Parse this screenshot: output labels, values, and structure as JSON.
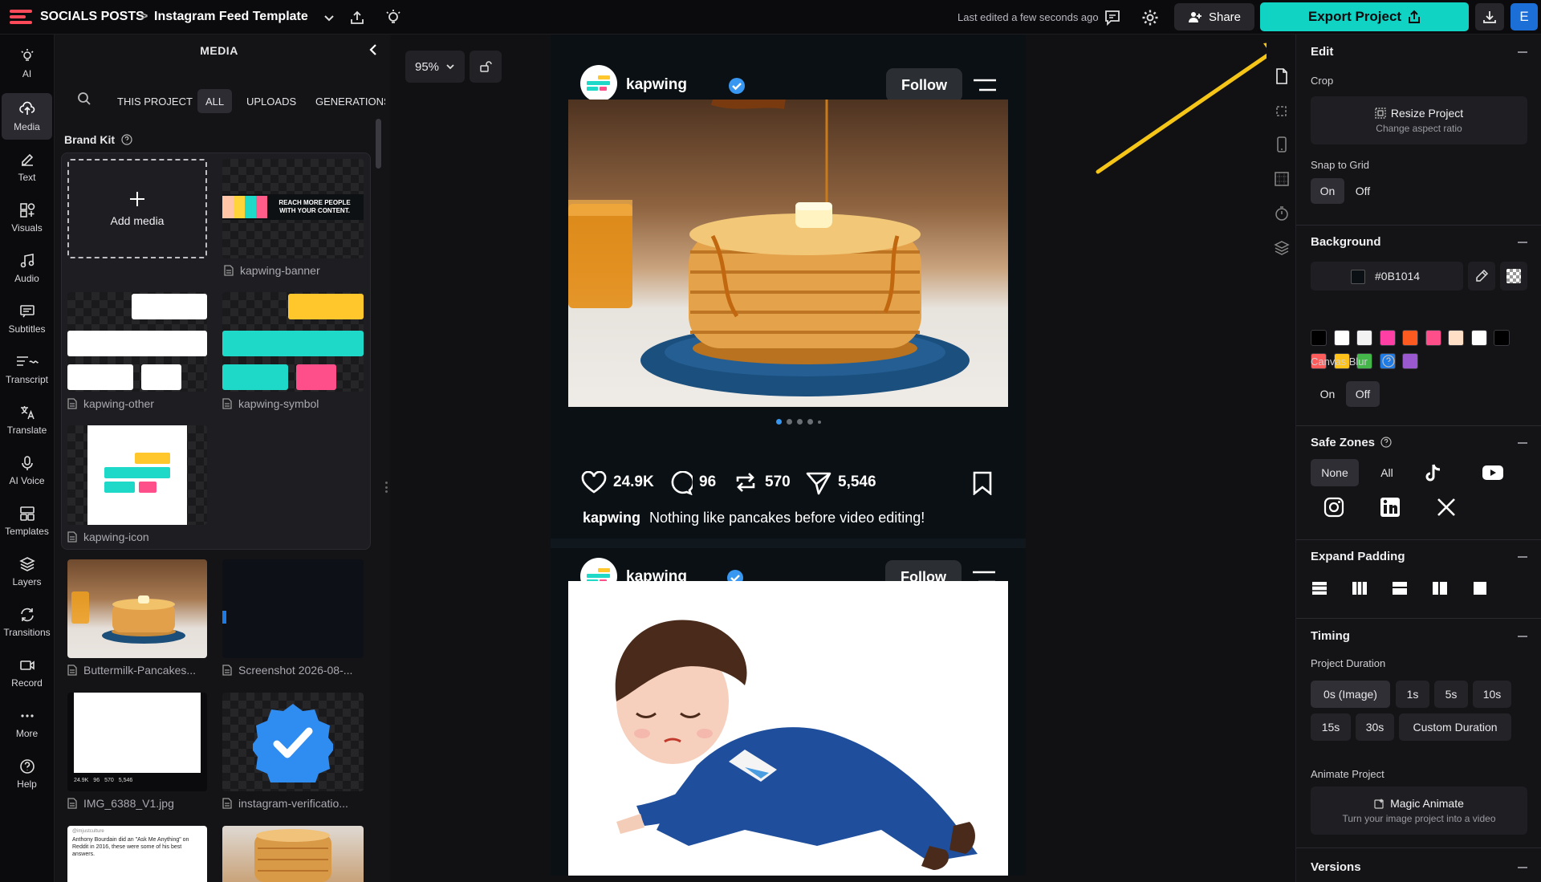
{
  "topbar": {
    "project_folder": "SOCIALS POSTS",
    "separator": ">",
    "project_name": "Instagram Feed Template",
    "last_edited": "Last edited a few seconds ago",
    "share_label": "Share",
    "export_label": "Export Project",
    "avatar_letter": "E"
  },
  "leftnav": {
    "items": [
      {
        "label": "AI",
        "icon": "ai-icon"
      },
      {
        "label": "Media",
        "icon": "upload-icon"
      },
      {
        "label": "Text",
        "icon": "text-icon"
      },
      {
        "label": "Visuals",
        "icon": "shapes-icon"
      },
      {
        "label": "Audio",
        "icon": "music-icon"
      },
      {
        "label": "Subtitles",
        "icon": "subtitles-icon"
      },
      {
        "label": "Transcript",
        "icon": "transcript-icon"
      },
      {
        "label": "Translate",
        "icon": "translate-icon"
      },
      {
        "label": "AI Voice",
        "icon": "microphone-icon"
      },
      {
        "label": "Templates",
        "icon": "templates-icon"
      },
      {
        "label": "Layers",
        "icon": "layers-icon"
      },
      {
        "label": "Transitions",
        "icon": "transitions-icon"
      },
      {
        "label": "Record",
        "icon": "record-icon"
      },
      {
        "label": "More",
        "icon": "more-icon"
      },
      {
        "label": "Help",
        "icon": "help-icon"
      }
    ],
    "active": "Media"
  },
  "media": {
    "title": "MEDIA",
    "filters": [
      "THIS PROJECT",
      "ALL",
      "UPLOADS",
      "GENERATIONS"
    ],
    "active_filter": "ALL",
    "brand_kit_label": "Brand Kit",
    "add_media_label": "Add media",
    "banner_text_line1": "REACH MORE PEOPLE",
    "banner_text_line2": "WITH YOUR CONTENT.",
    "files": {
      "banner": "kapwing-banner",
      "other": "kapwing-other",
      "symbol": "kapwing-symbol",
      "icon": "kapwing-icon",
      "pancakes": "Buttermilk-Pancakes...",
      "screenshot": "Screenshot 2026-08-...",
      "img": "IMG_6388_V1.jpg",
      "verification": "instagram-verificatio..."
    },
    "tweet_handle": "@imjustculture",
    "tweet_text": "Anthony Bourdain did an \"Ask Me Anything\" on Reddit in 2016, these were some of his best answers.",
    "mini_stats": [
      "24.9K",
      "96",
      "570",
      "5,546"
    ]
  },
  "canvas": {
    "zoom": "95%",
    "background_color": "#0B1014",
    "post1": {
      "username": "kapwing",
      "follow_label": "Follow",
      "likes": "24.9K",
      "comments": "96",
      "reposts": "570",
      "shares": "5,546",
      "caption_user": "kapwing",
      "caption_text": "Nothing like pancakes before video editing!"
    },
    "post2": {
      "username": "kapwing",
      "follow_label": "Follow"
    }
  },
  "rightpanel": {
    "edit_title": "Edit",
    "crop_label": "Crop",
    "resize_title": "Resize Project",
    "resize_sub": "Change aspect ratio",
    "snap_label": "Snap to Grid",
    "snap_on": "On",
    "snap_off": "Off",
    "snap_value": "On",
    "background_title": "Background",
    "background_hex": "#0B1014",
    "swatches": [
      "#000000",
      "#ffffff",
      "#f2f2f2",
      "#ff3fa4",
      "#ff5a1f",
      "#ff4f8b",
      "#ffe0c7",
      "#ffffff",
      "#000000",
      "#ff5c5c",
      "#ffc21a",
      "#45b649",
      "#1e7be6",
      "#9b59d0"
    ],
    "canvas_blur_label": "Canvas Blur",
    "blur_on": "On",
    "blur_off": "Off",
    "blur_value": "Off",
    "safe_zones_title": "Safe Zones",
    "safe_none": "None",
    "safe_all": "All",
    "safe_value": "None",
    "expand_padding_title": "Expand Padding",
    "timing_title": "Timing",
    "project_duration_label": "Project Duration",
    "durations_row1": [
      "0s (Image)",
      "1s",
      "5s",
      "10s"
    ],
    "durations_row2": [
      "15s",
      "30s",
      "Custom Duration"
    ],
    "duration_value": "0s (Image)",
    "animate_label": "Animate Project",
    "magic_title": "Magic Animate",
    "magic_sub": "Turn your image project into a video",
    "versions_title": "Versions"
  },
  "colors": {
    "accent": "#10D3C4",
    "annotation_arrow": "#F5C518"
  }
}
